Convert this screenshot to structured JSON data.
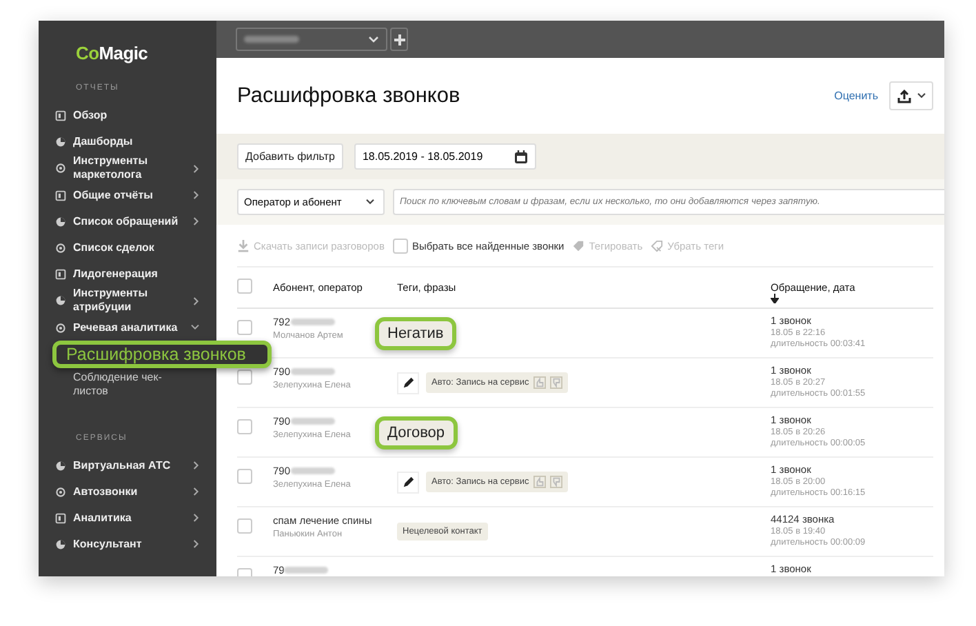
{
  "sidebar": {
    "logo": [
      "Co",
      "Magic"
    ],
    "sections": [
      {
        "title": "ОТЧЕТЫ",
        "items": [
          {
            "label": "Обзор"
          },
          {
            "label": "Дашборды"
          },
          {
            "label": "Инструменты маркетолога",
            "expanded": false
          },
          {
            "label": "Общие отчёты",
            "expanded": false
          },
          {
            "label": "Список обращений",
            "expanded": false
          },
          {
            "label": "Список сделок"
          },
          {
            "label": "Лидогенерация"
          },
          {
            "label": "Инструменты атрибуции",
            "expanded": false
          },
          {
            "label": "Речевая аналитика",
            "expanded": true,
            "children": [
              {
                "label": "Расшифровка звонков",
                "selected": true
              },
              {
                "label": "Соблюдение чек-листов",
                "selected": false
              }
            ]
          }
        ]
      },
      {
        "title": "СЕРВИСЫ",
        "items": [
          {
            "label": "Виртуальная АТС",
            "expanded": false
          },
          {
            "label": "Автозвонки",
            "expanded": false
          },
          {
            "label": "Аналитика",
            "expanded": false
          },
          {
            "label": "Консультант",
            "expanded": false
          }
        ]
      }
    ]
  },
  "page": {
    "title": "Расшифровка звонков",
    "rate_link": "Оценить"
  },
  "filters": {
    "add_button": "Добавить фильтр",
    "date_range": "18.05.2019 - 18.05.2019",
    "speaker_select": "Оператор и абонент",
    "search": {
      "placeholder": "Поиск по ключевым словам и фразам, если их несколько, то они добавляются через запятую."
    }
  },
  "toolbar": [
    {
      "kind": "download",
      "label": "Скачать записи разговоров",
      "disabled": true
    },
    {
      "kind": "checkbox",
      "label": "Выбрать все найденные звонки",
      "disabled": false,
      "checked": false
    },
    {
      "kind": "tag",
      "label": "Тегировать",
      "disabled": true
    },
    {
      "kind": "untag",
      "label": "Убрать теги",
      "disabled": true
    }
  ],
  "table": {
    "header_checked": false,
    "columns": [
      "Абонент, оператор",
      "Теги, фразы",
      "Обращение, дата"
    ],
    "rows": [
      {
        "checked": false,
        "phone": "792",
        "name": "Молчанов Артем",
        "editable": false,
        "tags": [
          {
            "kind": "callout",
            "label": "Негатив"
          }
        ],
        "calls": "1 звонок",
        "time": "18.05 в 22:16",
        "duration": "длительность 00:03:41"
      },
      {
        "checked": false,
        "phone": "790",
        "name": "Зелепухина Елена",
        "editable": true,
        "tags": [
          {
            "kind": "auto",
            "label": "Авто: Запись на сервис"
          }
        ],
        "calls": "1 звонок",
        "time": "18.05 в 20:27",
        "duration": "длительность 00:01:55"
      },
      {
        "checked": false,
        "phone": "790",
        "name": "Зелепухина Елена",
        "editable": false,
        "tags": [
          {
            "kind": "callout",
            "label": "Договор"
          }
        ],
        "calls": "1 звонок",
        "time": "18.05 в 20:26",
        "duration": "длительность 00:00:05"
      },
      {
        "checked": false,
        "phone": "790",
        "name": "Зелепухина Елена",
        "editable": true,
        "tags": [
          {
            "kind": "auto",
            "label": "Авто: Запись на сервис"
          }
        ],
        "calls": "1 звонок",
        "time": "18.05 в 20:00",
        "duration": "длительность 00:16:15"
      },
      {
        "checked": false,
        "phone": "спам лечение спины",
        "name": "Паньюкин Антон",
        "editable": false,
        "tags": [
          {
            "kind": "plain",
            "label": "Нецелевой контакт"
          }
        ],
        "calls": "44124 звонка",
        "time": "18.05 в 19:40",
        "duration": "длительность 00:00:09"
      },
      {
        "checked": false,
        "phone": "79",
        "calls": "1 звонок"
      }
    ]
  }
}
